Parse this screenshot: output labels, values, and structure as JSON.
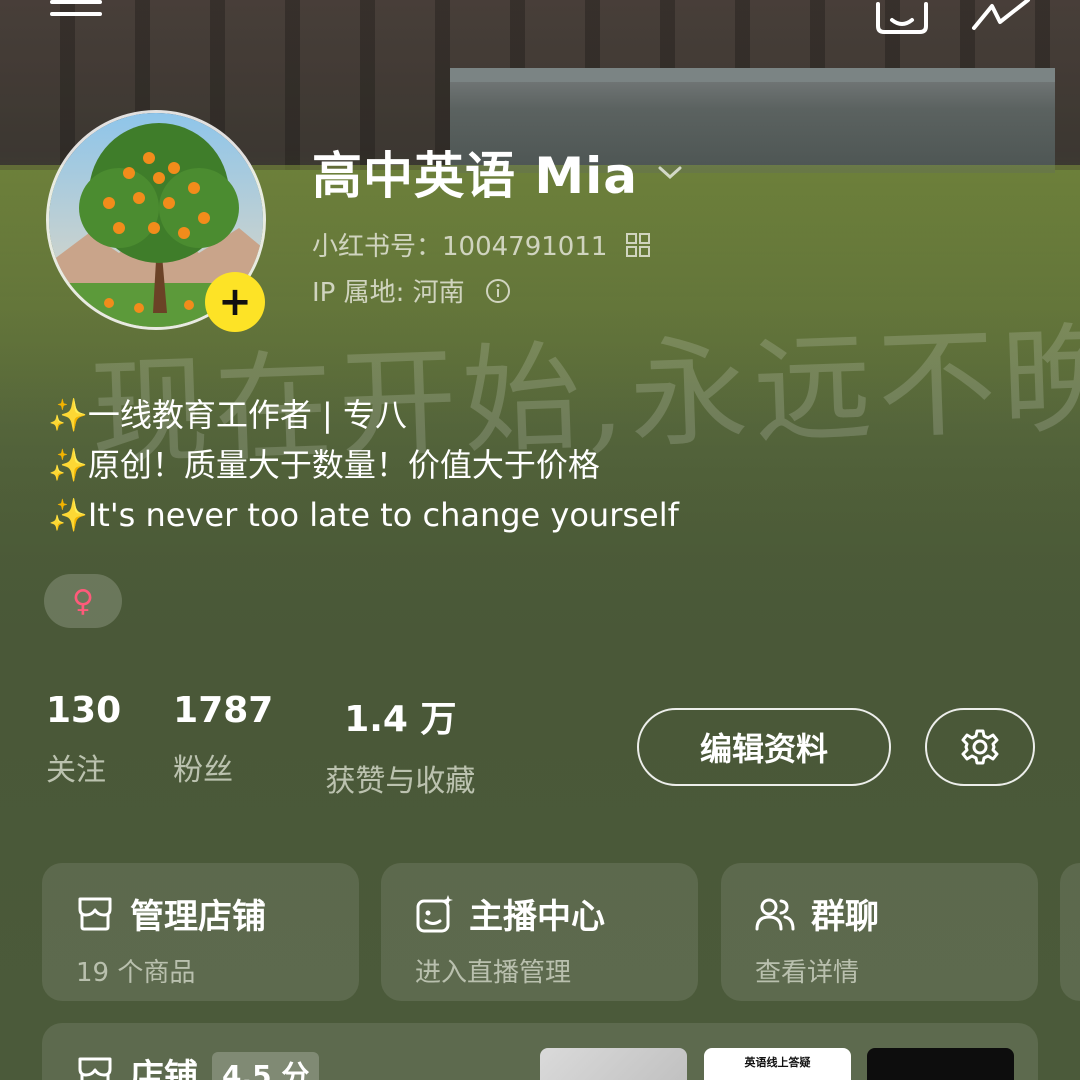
{
  "profile": {
    "name": "高中英语 Mia",
    "xhs_id": "小红书号：1004791011",
    "ip": "IP 属地: 河南",
    "bio": [
      "一线教育工作者 | 专八",
      "原创！质量大于数量！价值大于价格",
      "It's never too late to change yourself"
    ],
    "sparkle": "✨",
    "gender_symbol": "♀",
    "background_watermark": "现在开始,永远不晚"
  },
  "stats": [
    {
      "value": "130",
      "label": "关注"
    },
    {
      "value": "1787",
      "label": "粉丝"
    },
    {
      "value": "1.4 万",
      "label": "获赞与收藏"
    }
  ],
  "actions": {
    "edit_profile": "编辑资料"
  },
  "cards": [
    {
      "title": "管理店铺",
      "subtitle": "19 个商品",
      "icon": "shop-icon"
    },
    {
      "title": "主播中心",
      "subtitle": "进入直播管理",
      "icon": "live-icon"
    },
    {
      "title": "群聊",
      "subtitle": "查看详情",
      "icon": "group-icon"
    }
  ],
  "shop": {
    "title": "店铺",
    "rating": "4.5 分",
    "thumb2_text": "英语线上答疑"
  },
  "colors": {
    "accent_yellow": "#fde326",
    "gender_pink": "#ff5a7a",
    "background_green": "#4b5a3a"
  }
}
